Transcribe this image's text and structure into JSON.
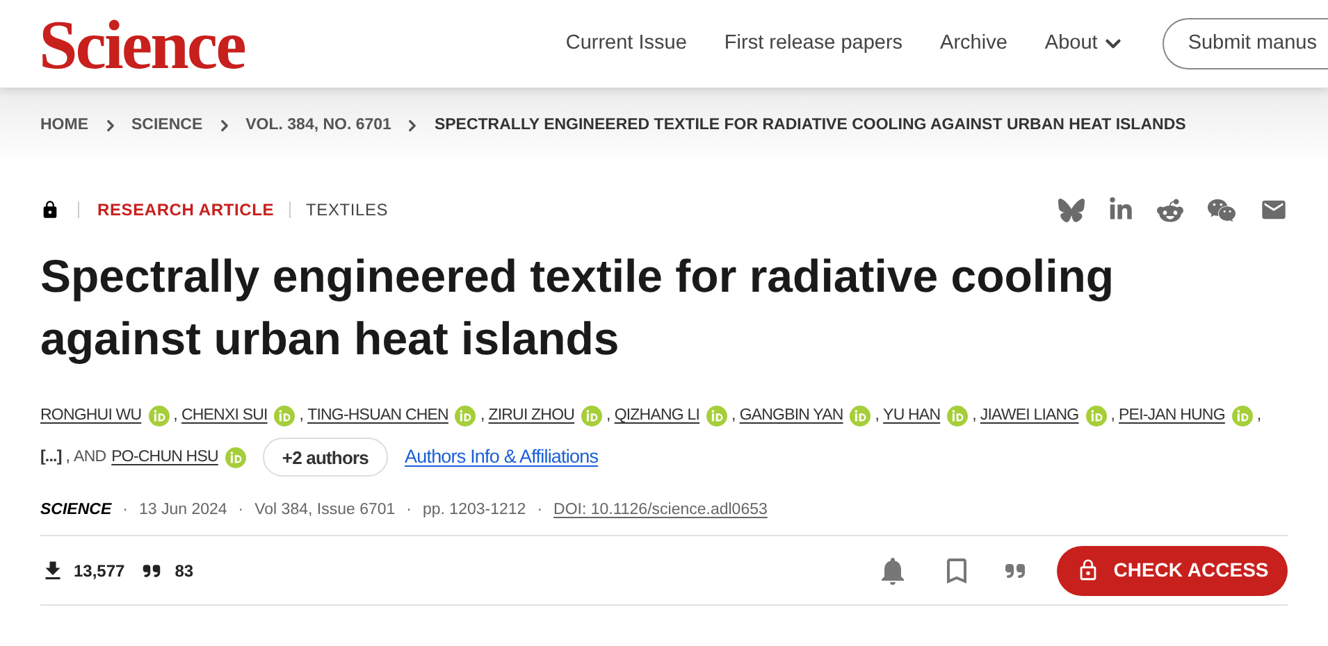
{
  "header": {
    "logo": "Science",
    "nav": [
      {
        "label": "Current Issue",
        "kind": "link"
      },
      {
        "label": "First release papers",
        "kind": "link"
      },
      {
        "label": "Archive",
        "kind": "link"
      },
      {
        "label": "About",
        "kind": "menu"
      }
    ],
    "submit_button": "Submit manus"
  },
  "breadcrumb": [
    "HOME",
    "SCIENCE",
    "VOL. 384, NO. 6701",
    "SPECTRALLY ENGINEERED TEXTILE FOR RADIATIVE COOLING AGAINST URBAN HEAT ISLANDS"
  ],
  "article": {
    "locked": true,
    "type": "RESEARCH ARTICLE",
    "subject": "TEXTILES",
    "title": "Spectrally engineered textile for radiative cooling against urban heat islands",
    "authors": [
      {
        "kind": "author",
        "name": "RONGHUI WU",
        "sep": ","
      },
      {
        "kind": "author",
        "name": "CHENXI SUI",
        "sep": ","
      },
      {
        "kind": "author",
        "name": "TING-HSUAN CHEN",
        "sep": ","
      },
      {
        "kind": "author",
        "name": "ZIRUI ZHOU",
        "sep": ","
      },
      {
        "kind": "author",
        "name": "QIZHANG LI",
        "sep": ","
      },
      {
        "kind": "author",
        "name": "GANGBIN YAN",
        "sep": ","
      },
      {
        "kind": "author",
        "name": "YU HAN",
        "sep": ","
      },
      {
        "kind": "author",
        "name": "JIAWEI LIANG",
        "sep": ","
      },
      {
        "kind": "author",
        "name": "PEI-JAN HUNG",
        "sep": ","
      },
      {
        "kind": "ellipsis",
        "name": "[...]",
        "sep": ","
      },
      {
        "kind": "author",
        "prefix": "AND",
        "name": "PO-CHUN HSU"
      }
    ],
    "more_authors": "+2 authors",
    "affiliations_link": "Authors Info & Affiliations",
    "meta_separator": "·",
    "meta": [
      {
        "kind": "journal",
        "text": "SCIENCE"
      },
      {
        "kind": "plain",
        "text": "13 Jun 2024"
      },
      {
        "kind": "plain",
        "text": "Vol 384, Issue 6701"
      },
      {
        "kind": "plain",
        "text": "pp. 1203-1212"
      },
      {
        "kind": "link",
        "text": "DOI: 10.1126/science.adl0653"
      }
    ],
    "downloads": "13,577",
    "citations": "83",
    "check_access": "CHECK ACCESS"
  }
}
